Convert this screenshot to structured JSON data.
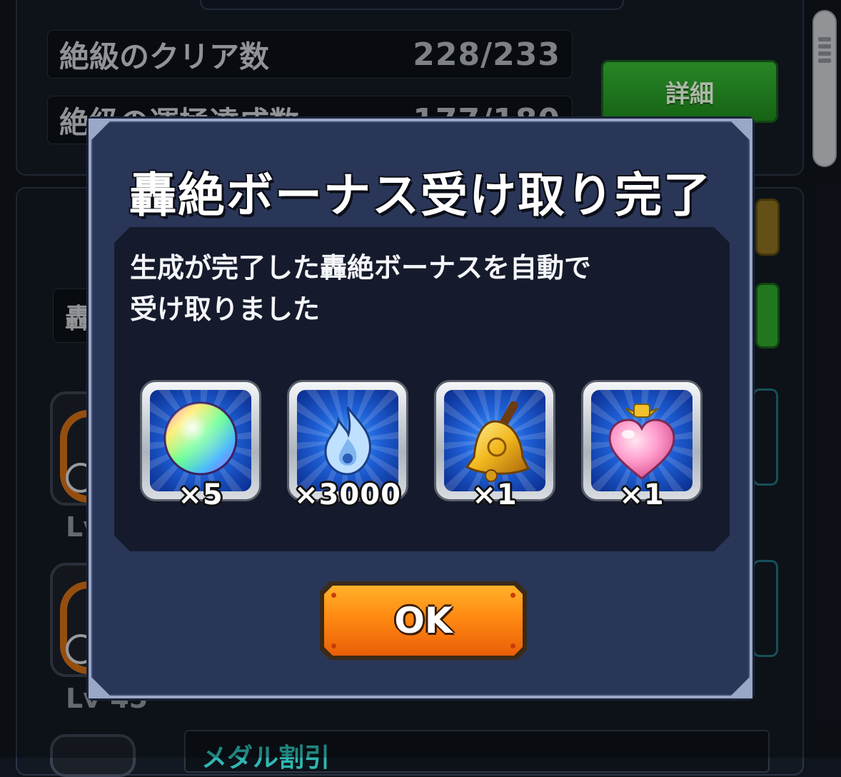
{
  "background": {
    "stats": [
      {
        "label": "絶級のクリア数",
        "value": "228/233"
      },
      {
        "label": "絶級の運極達成数",
        "value": "177/180"
      }
    ],
    "detail_button": "詳細",
    "list_label_partial": "轟",
    "unit_levels": [
      "Lv",
      "Lv 45"
    ],
    "bottom_item": "メダル割引"
  },
  "dialog": {
    "title": "轟絶ボーナス受け取り完了",
    "message_line1": "生成が完了した轟絶ボーナスを自動で",
    "message_line2": "受け取りました",
    "rewards": [
      {
        "icon": "rainbow-orb-icon",
        "quantity": "×5"
      },
      {
        "icon": "blue-flame-icon",
        "quantity": "×3000"
      },
      {
        "icon": "golden-bell-icon",
        "quantity": "×1"
      },
      {
        "icon": "heart-potion-icon",
        "quantity": "×1"
      }
    ],
    "ok_label": "OK"
  },
  "colors": {
    "dialog_bg": "#2a3658",
    "dialog_border": "#9aa7c6",
    "ok_button": "#ff8a12",
    "detail_button": "#2fa52d"
  }
}
